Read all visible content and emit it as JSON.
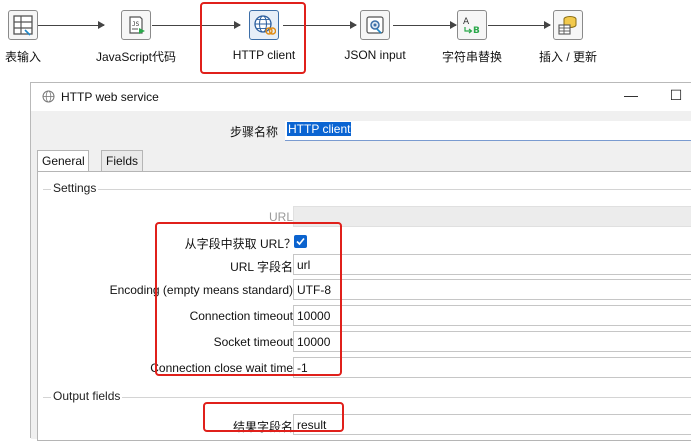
{
  "pipeline": {
    "steps": [
      {
        "label": "表输入",
        "icon": "table-input-icon"
      },
      {
        "label": "JavaScript代码",
        "icon": "javascript-script-icon"
      },
      {
        "label": "HTTP client",
        "icon": "http-client-globe-icon"
      },
      {
        "label": "JSON input",
        "icon": "json-input-icon"
      },
      {
        "label": "字符串替换",
        "icon": "string-replace-icon"
      },
      {
        "label": "插入 / 更新",
        "icon": "insert-update-icon"
      }
    ],
    "highlight_color": "#e0201b"
  },
  "dialog": {
    "title": "HTTP web service",
    "minimize": "—",
    "maximize": "☐",
    "step_name_label": "步骤名称",
    "step_name_value": "HTTP client",
    "tabs": [
      "General",
      "Fields"
    ],
    "settings": {
      "title": "Settings",
      "url_label": "URL",
      "url_value": "",
      "url_from_field_label": "从字段中获取 URL？",
      "url_from_field_checked": true,
      "url_field_name_label": "URL 字段名",
      "url_field_name_value": "url",
      "encoding_label": "Encoding (empty means standard)",
      "encoding_value": "UTF-8",
      "connection_timeout_label": "Connection timeout",
      "connection_timeout_value": "10000",
      "socket_timeout_label": "Socket timeout",
      "socket_timeout_value": "10000",
      "close_wait_label": "Connection close wait time",
      "close_wait_value": "-1"
    },
    "output": {
      "title": "Output fields",
      "result_field_label": "结果字段名",
      "result_field_value": "result"
    }
  }
}
